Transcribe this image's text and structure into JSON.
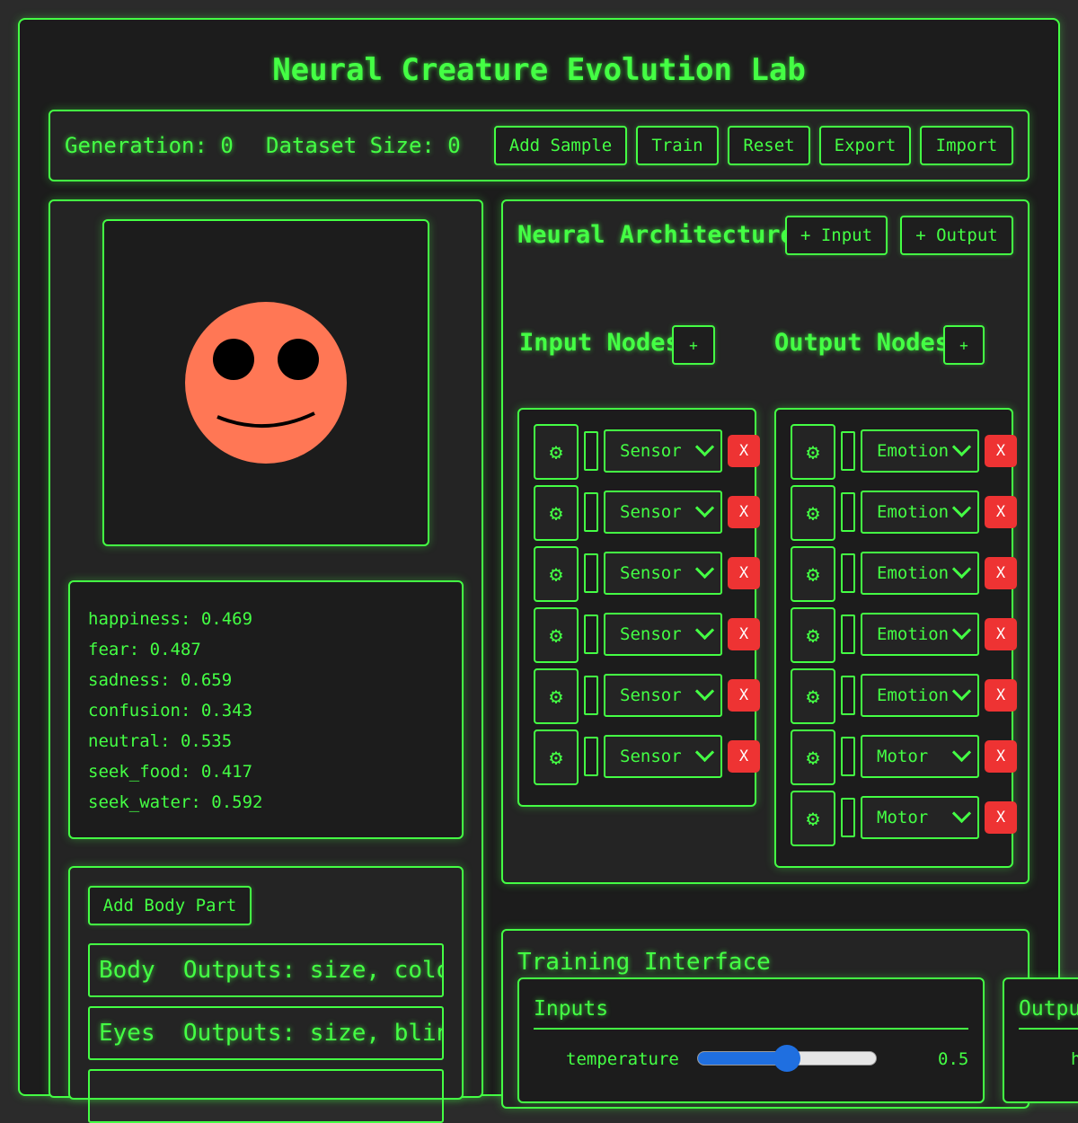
{
  "title": "Neural Creature Evolution Lab",
  "toolbar": {
    "generation": "Generation: 0",
    "dataset": "Dataset Size: 0",
    "buttons": [
      "Add Sample",
      "Train",
      "Reset",
      "Export",
      "Import"
    ]
  },
  "creature": {
    "color": "#ff7755"
  },
  "emotions": [
    "happiness: 0.469",
    "fear: 0.487",
    "sadness: 0.659",
    "confusion: 0.343",
    "neutral: 0.535",
    "seek_food: 0.417",
    "seek_water: 0.592"
  ],
  "body_parts": {
    "add_label": "Add Body Part",
    "items": [
      "Body  Outputs: size, color",
      "Eyes  Outputs: size, blink"
    ]
  },
  "architecture": {
    "title": "Neural Architecture",
    "add_input_label": "+ Input",
    "add_output_label": "+ Output",
    "inputs_title": "Input Nodes",
    "outputs_title": "Output Nodes",
    "plus": "+",
    "gear_glyph": "⚙",
    "remove_label": "X",
    "input_nodes": [
      "Sensor",
      "Sensor",
      "Sensor",
      "Sensor",
      "Sensor",
      "Sensor"
    ],
    "output_nodes": [
      "Emotion",
      "Emotion",
      "Emotion",
      "Emotion",
      "Emotion",
      "Motor",
      "Motor"
    ]
  },
  "training": {
    "title": "Training Interface",
    "inputs_title": "Inputs",
    "outputs_title": "Outpu",
    "slider_label": "temperature",
    "slider_value": "0.5",
    "slider_fraction": 0.5,
    "outputs_partial": "h"
  }
}
